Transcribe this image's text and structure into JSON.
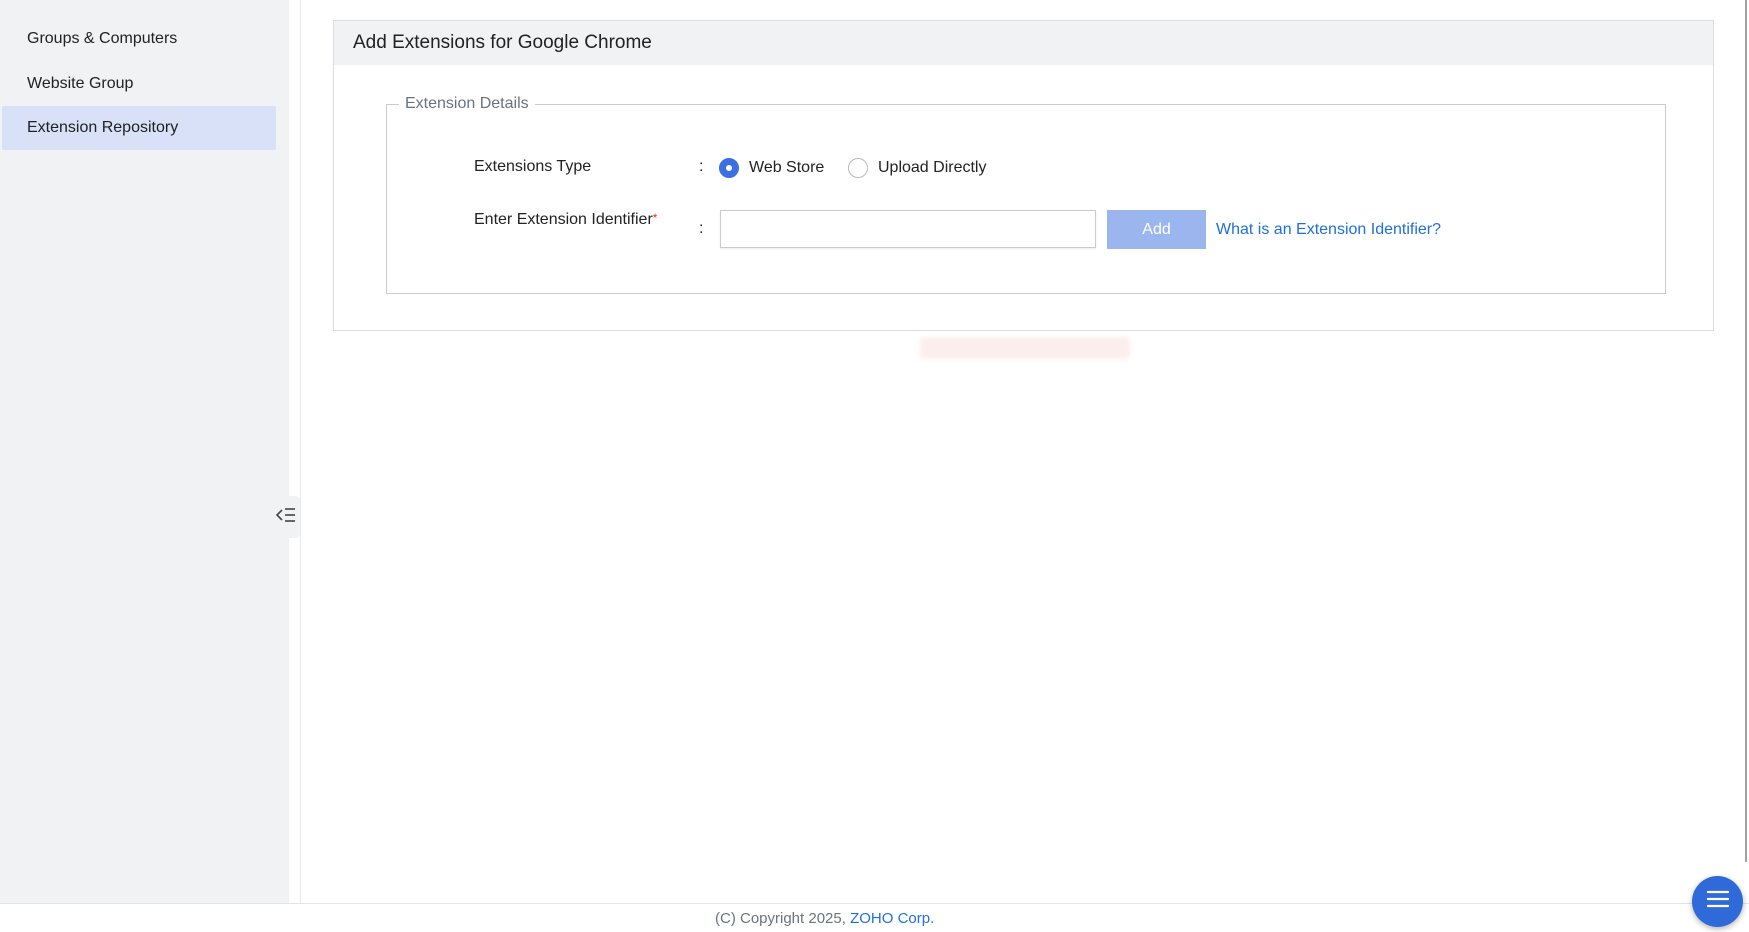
{
  "sidebar": {
    "items": [
      {
        "label": "Groups & Computers",
        "active": false
      },
      {
        "label": "Website Group",
        "active": false
      },
      {
        "label": "Extension Repository",
        "active": true
      }
    ],
    "collapse_icon": "collapse-sidebar-icon"
  },
  "panel": {
    "title": "Add Extensions for Google Chrome",
    "fieldset_legend": "Extension Details",
    "extensions_type": {
      "label": "Extensions Type",
      "colon": ":",
      "options": [
        {
          "label": "Web Store",
          "checked": true
        },
        {
          "label": "Upload Directly",
          "checked": false
        }
      ]
    },
    "identifier": {
      "label": "Enter Extension Identifier",
      "required_mark": "*",
      "colon": ":",
      "value": "",
      "add_label": "Add",
      "help_link": "What is an Extension Identifier?"
    }
  },
  "footer": {
    "copyright": "(C) Copyright 2025,",
    "company_link": "ZOHO Corp."
  },
  "fab_icon": "menu-icon",
  "colors": {
    "accent": "#3c6fe0",
    "link": "#1f6fe0",
    "add_button_disabled": "#9bb6ef",
    "sidebar_bg": "#f1f2f4",
    "sidebar_active": "#d8e1f8",
    "required": "#e0303a"
  }
}
